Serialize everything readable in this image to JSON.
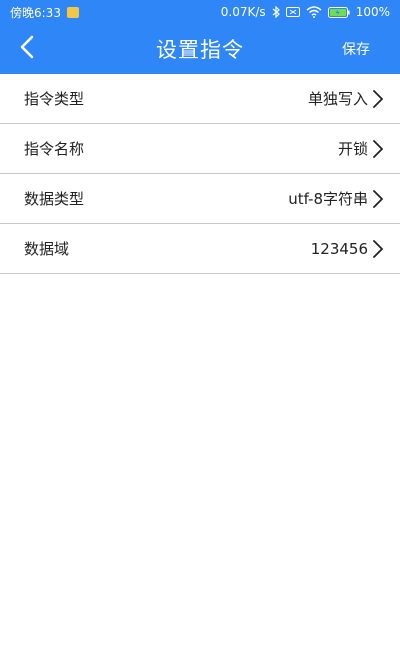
{
  "status_bar": {
    "time": "傍晚6:33",
    "speed": "0.07K/s",
    "battery": "100%",
    "icons": [
      "notification-icon",
      "bluetooth-icon",
      "sim-icon",
      "wifi-icon",
      "battery-icon"
    ]
  },
  "header": {
    "title": "设置指令",
    "save_label": "保存",
    "back_icon": "chevron-left-icon"
  },
  "rows": [
    {
      "label": "指令类型",
      "value": "单独写入"
    },
    {
      "label": "指令名称",
      "value": "开锁"
    },
    {
      "label": "数据类型",
      "value": "utf-8字符串"
    },
    {
      "label": "数据域",
      "value": "123456"
    }
  ],
  "colors": {
    "accent": "#2f86f6",
    "divider": "#c8c8c8",
    "text": "#222222"
  }
}
